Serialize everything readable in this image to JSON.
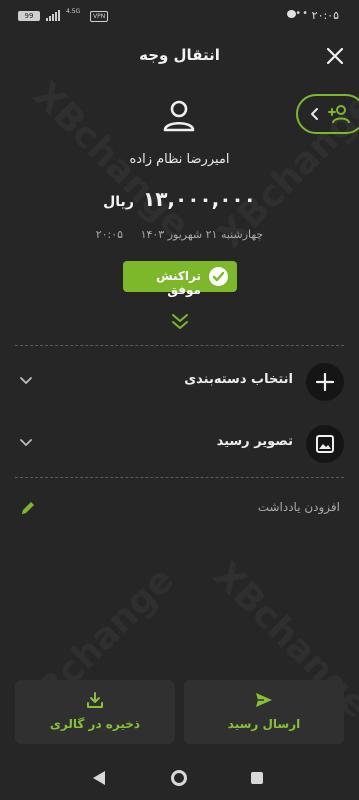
{
  "status_bar": {
    "time": "۲۰:۰۵",
    "battery": "99",
    "network": "4.5G",
    "vpn": "VPN",
    "icons": [
      "chat-icon",
      "more-dots-icon",
      "signal-icon",
      "battery-icon"
    ]
  },
  "header": {
    "title": "انتقال وجه",
    "close_icon": "close-icon"
  },
  "watermark": "XBchange",
  "recipient": {
    "name": "امیررضا نظام زاده",
    "amount": "۱۳,۰۰۰,۰۰۰",
    "currency": "ریال",
    "date": "چهارشنبه ۲۱ شهریور ۱۴۰۳",
    "time": "۲۰:۰۵"
  },
  "status_badge": {
    "label": "تراکنش موفق",
    "color": "#7cb82a"
  },
  "rows": {
    "category": "انتخاب دسته‌بندی",
    "receipt_image": "تصویر رسید",
    "note": "افزودن یادداشت"
  },
  "actions": {
    "send_receipt": "ارسال رسید",
    "save_gallery": "ذخیره در گالری"
  },
  "colors": {
    "background": "#262626",
    "accent": "#7cb82a",
    "card": "#303030"
  }
}
